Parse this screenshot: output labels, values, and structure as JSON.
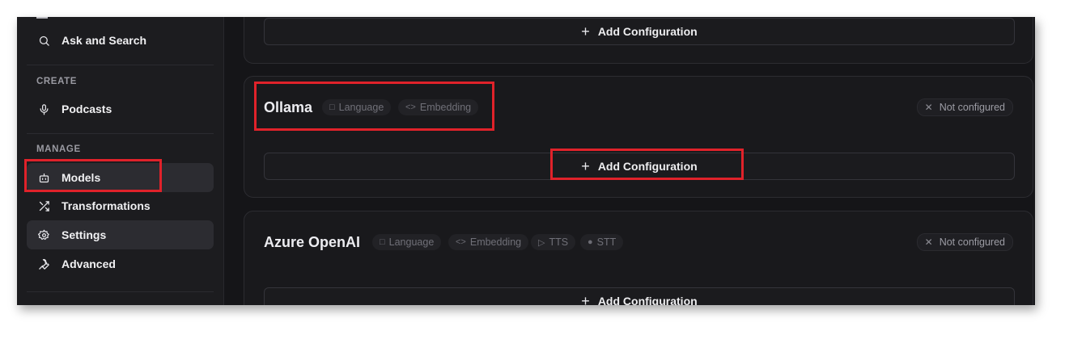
{
  "sidebar": {
    "ask_search": "Ask and Search",
    "create_label": "CREATE",
    "podcasts": "Podcasts",
    "manage_label": "MANAGE",
    "models": "Models",
    "transformations": "Transformations",
    "settings": "Settings",
    "advanced": "Advanced"
  },
  "cards": {
    "top": {
      "add_label": "Add Configuration"
    },
    "ollama": {
      "title": "Ollama",
      "badges": [
        "Language",
        "Embedding"
      ],
      "status": "Not configured",
      "add_label": "Add Configuration"
    },
    "azure": {
      "title": "Azure OpenAI",
      "badges": [
        "Language",
        "Embedding",
        "TTS",
        "STT"
      ],
      "status": "Not configured",
      "add_label": "Add Configuration"
    }
  },
  "annotation_color": "#e0222a"
}
